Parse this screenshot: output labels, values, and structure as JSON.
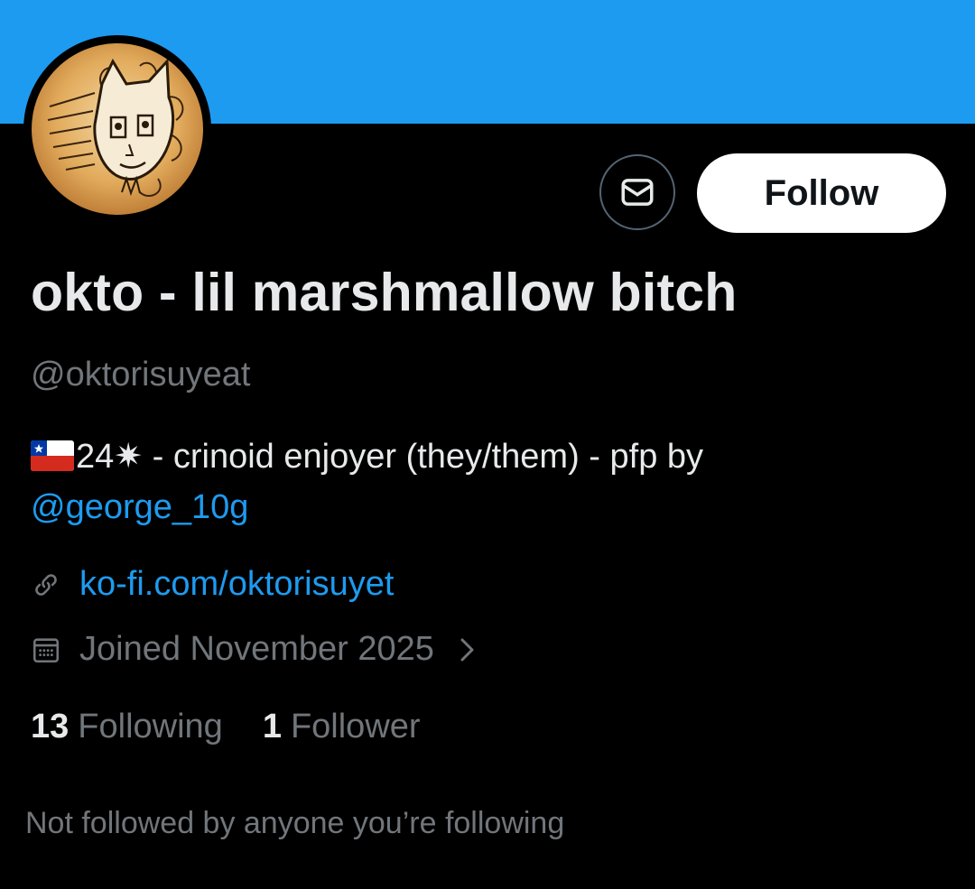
{
  "profile": {
    "display_name": "okto - lil marshmallow bitch",
    "handle": "@oktorisuyeat",
    "bio": {
      "flag_icon": "chile-flag-icon",
      "text": "24✷ - crinoid enjoyer (they/them) - pfp by",
      "mention": "@george_10g"
    },
    "website": "ko-fi.com/oktorisuyet",
    "joined": "Joined November 2025"
  },
  "actions": {
    "message_icon": "envelope-icon",
    "follow_label": "Follow"
  },
  "stats": {
    "following_count": "13",
    "following_label": "Following",
    "followers_count": "1",
    "followers_label": "Follower"
  },
  "footer": {
    "mutuals_text": "Not followed by anyone you’re following"
  },
  "colors": {
    "banner": "#1d9bf0",
    "background": "#000000",
    "link": "#1d9bf0",
    "secondary_text": "#71767b",
    "primary_text": "#e7e9ea"
  }
}
